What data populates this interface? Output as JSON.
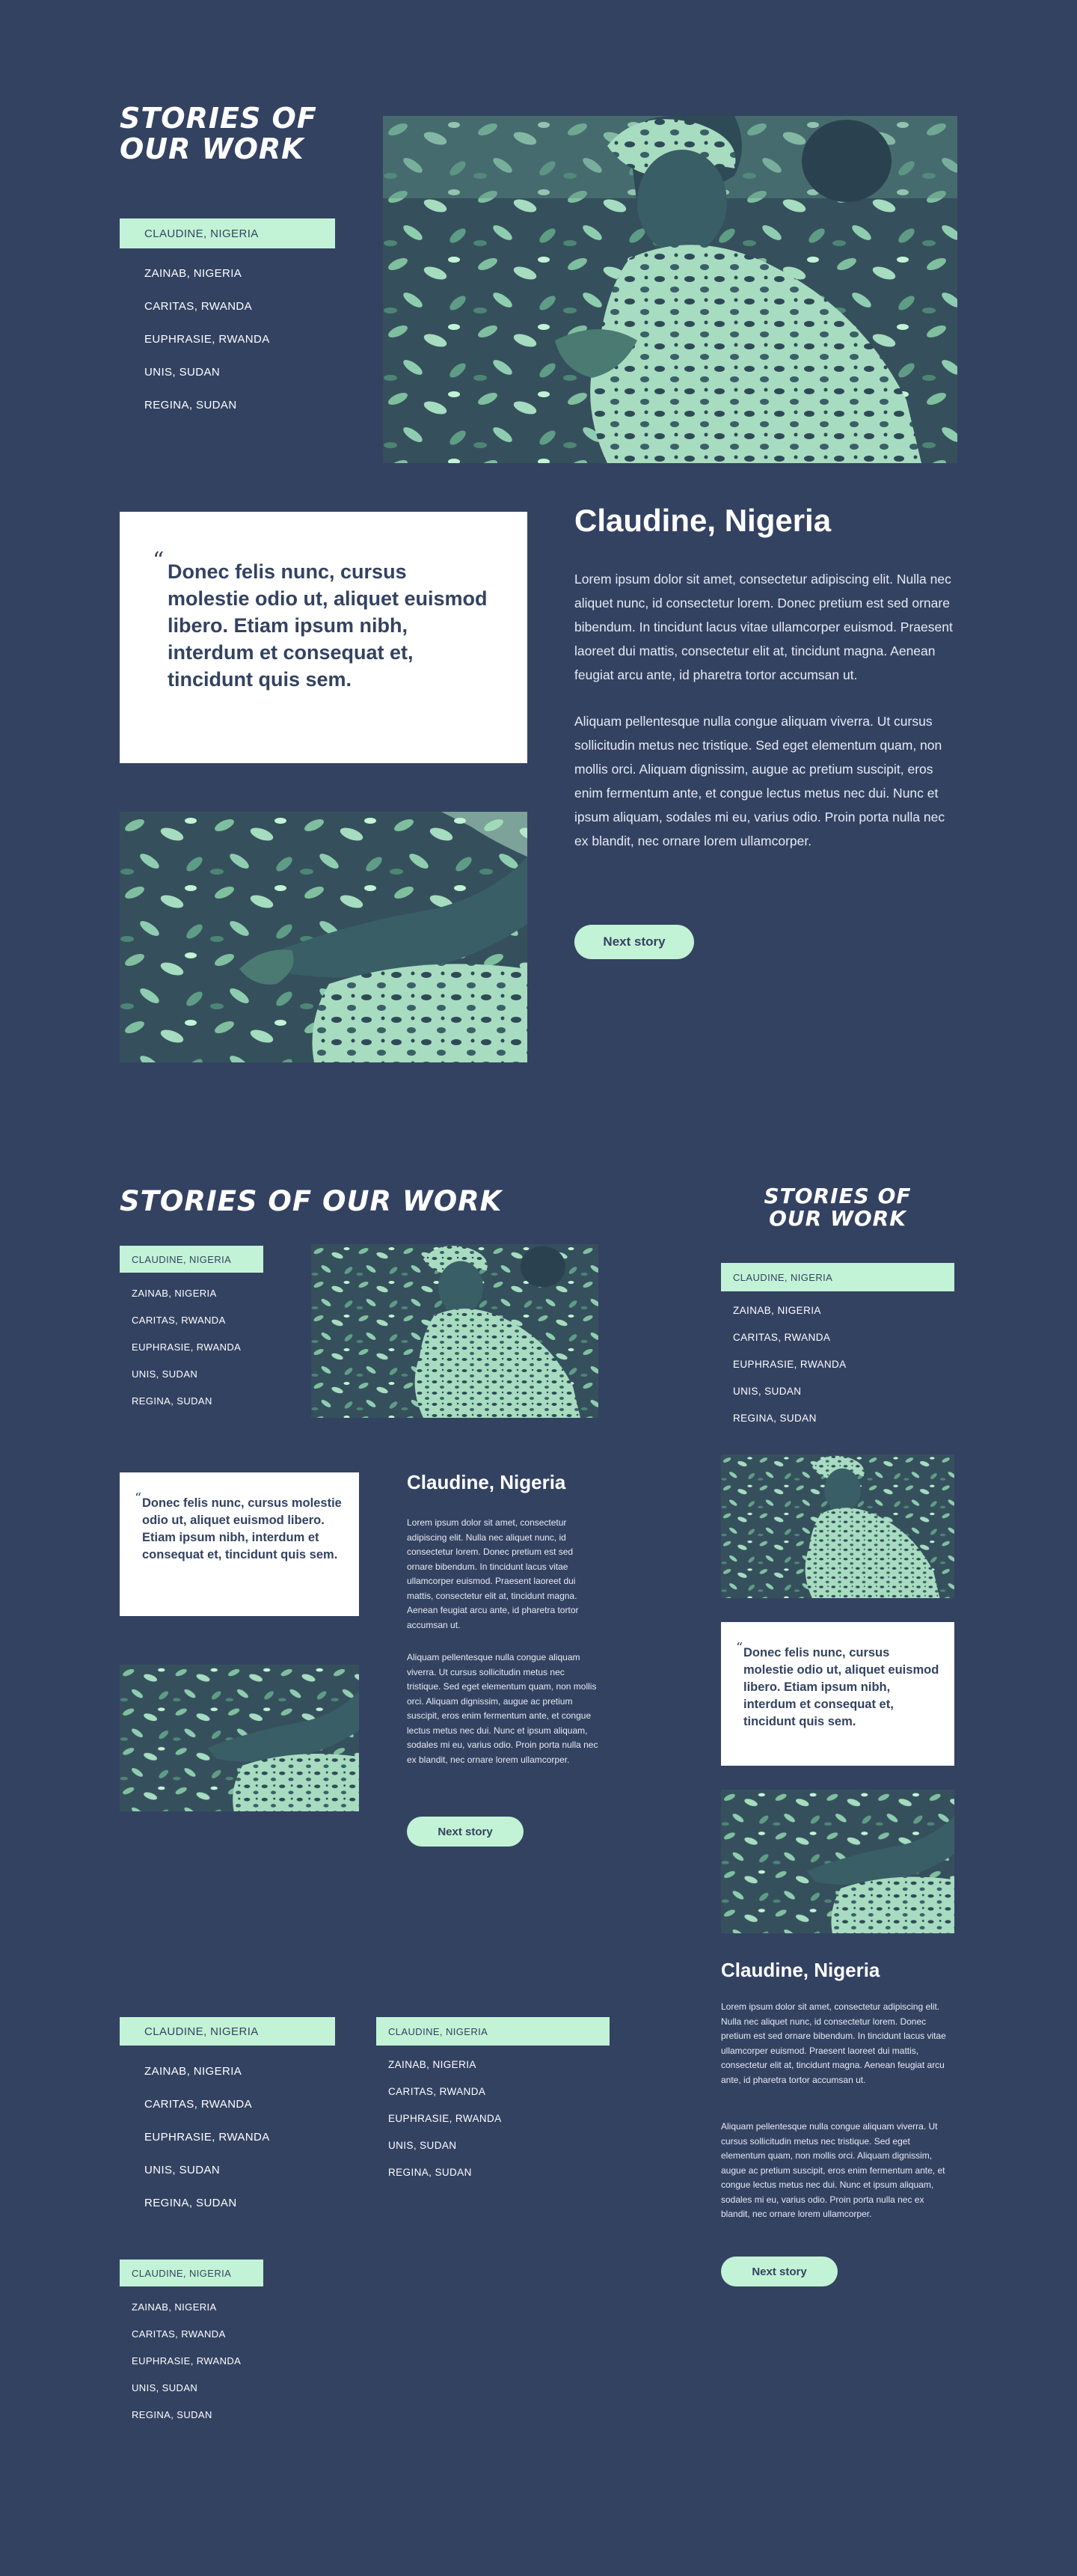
{
  "heading": "STORIES OF OUR WORK",
  "heading_line1": "STORIES OF",
  "heading_line2": "OUR WORK",
  "nav": {
    "active": "CLAUDINE, NIGERIA",
    "items": [
      "ZAINAB, NIGERIA",
      "CARITAS, RWANDA",
      "EUPHRASIE, RWANDA",
      "UNIS, SUDAN",
      "REGINA, SUDAN"
    ]
  },
  "story": {
    "title": "Claudine, Nigeria",
    "quote_mark": "“",
    "quote": "Donec felis nunc, cursus molestie odio ut, aliquet euismod libero. Etiam ipsum nibh, interdum et consequat et, tincidunt quis sem.",
    "paragraph1": "Lorem ipsum dolor sit amet, consectetur adipiscing elit. Nulla nec aliquet nunc, id consectetur lorem. Donec pretium est sed ornare bibendum. In tincidunt lacus vitae ullamcorper euismod. Praesent laoreet dui mattis, consectetur elit at, tincidunt magna. Aenean feugiat arcu ante, id pharetra tortor accumsan ut.",
    "paragraph2": "Aliquam pellentesque nulla congue aliquam viverra. Ut cursus sollicitudin metus nec tristique. Sed eget elementum quam, non mollis orci. Aliquam dignissim, augue ac pretium suscipit, eros enim fermentum ante, et congue lectus metus nec dui. Nunc et ipsum aliquam, sodales mi eu, varius odio. Proin porta nulla nec ex blandit, nec ornare lorem ullamcorper.",
    "button": "Next story"
  },
  "colors": {
    "background": "#344262",
    "accent": "#c3f3d6",
    "card": "#ffffff",
    "text_dark": "#344262"
  }
}
